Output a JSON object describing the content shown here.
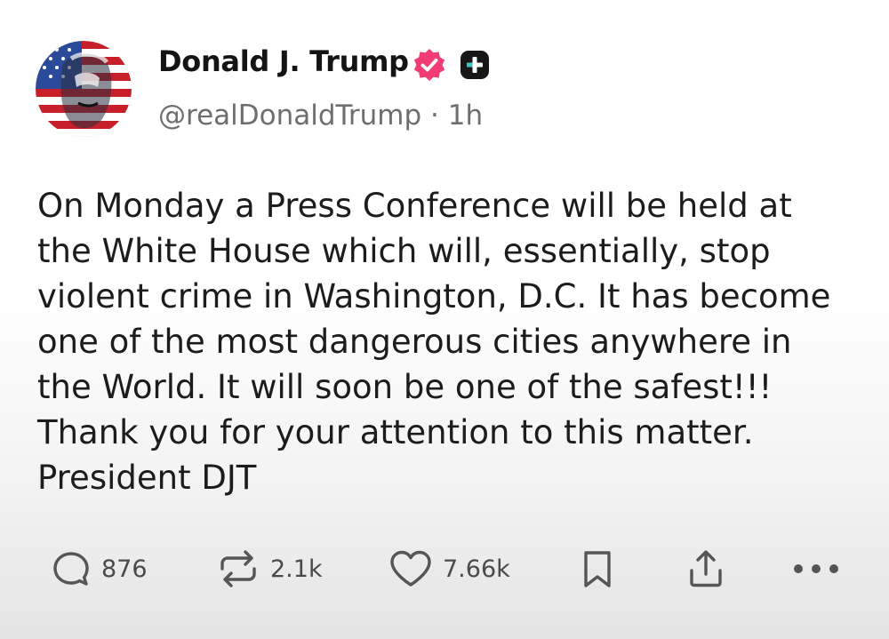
{
  "author": {
    "display_name": "Donald J. Trump",
    "handle": "@realDonaldTrump",
    "separator": "·",
    "time_ago": "1h",
    "verified_badge_icon": "verified-check-icon",
    "verified_badge_color": "#f13d73",
    "membership_badge_icon": "plus-badge-icon"
  },
  "post": {
    "text": "On Monday a Press Conference will be held at\nthe White House which will, essentially, stop\nviolent crime in Washington, D.C. It has become\none of the most dangerous cities anywhere in\nthe World. It will soon be one of the safest!!!\nThank you for your attention to this matter.\nPresident DJT"
  },
  "actions": {
    "reply": {
      "icon": "reply-icon",
      "count": "876"
    },
    "repost": {
      "icon": "repost-icon",
      "count": "2.1k"
    },
    "like": {
      "icon": "heart-icon",
      "count": "7.66k"
    },
    "bookmark": {
      "icon": "bookmark-icon"
    },
    "share": {
      "icon": "share-icon"
    },
    "more": {
      "icon": "more-icon"
    }
  },
  "colors": {
    "text_primary": "#1c1c1c",
    "text_secondary": "#6e6e6e",
    "icon": "#555555"
  }
}
